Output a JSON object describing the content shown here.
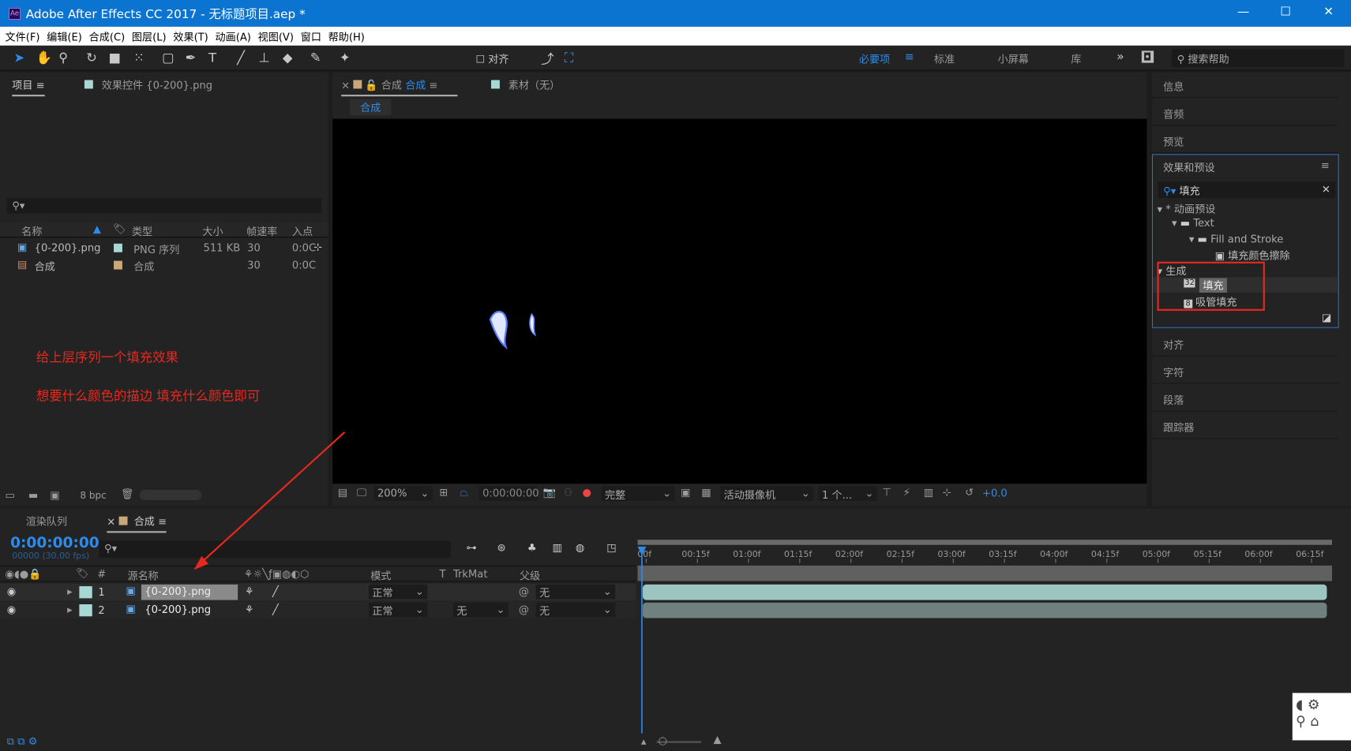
{
  "window": {
    "title": "Adobe After Effects CC 2017 - 无标题项目.aep *",
    "app_icon": "Ae",
    "controls": [
      "—",
      "☐",
      "✕"
    ]
  },
  "menu": [
    "文件(F)",
    "编辑(E)",
    "合成(C)",
    "图层(L)",
    "效果(T)",
    "动画(A)",
    "视图(V)",
    "窗口",
    "帮助(H)"
  ],
  "toolbar": {
    "align_label": "对齐",
    "workspaces": [
      "必要项",
      "标准",
      "小屏幕",
      "库"
    ],
    "active_workspace": "必要项",
    "more": "»",
    "search_placeholder": "搜索帮助"
  },
  "project_panel": {
    "tab": "项目",
    "effect_controls_tab": "效果控件 {0-200}.png",
    "columns": [
      "名称",
      "类型",
      "大小",
      "帧速率",
      "入点"
    ],
    "items": [
      {
        "name": "{0-200}.png",
        "type": "PNG 序列",
        "size": "511 KB",
        "fps": "30",
        "in": "0:0C",
        "label_color": "#a8d8d4"
      },
      {
        "name": "合成",
        "type": "合成",
        "size": "",
        "fps": "30",
        "in": "0:0C",
        "label_color": "#c8a878"
      }
    ],
    "bpc": "8 bpc"
  },
  "comp_panel": {
    "tab_prefix": "合成",
    "tab_name": "合成",
    "footage_tab": "素材（无）",
    "subtab": "合成",
    "zoom": "200%",
    "timecode": "0:00:00:00",
    "resolution": "完整",
    "camera": "活动摄像机",
    "views": "1 个...",
    "exposure": "+0.0"
  },
  "annotations": [
    "给上层序列一个填充效果",
    "想要什么颜色的描边 填充什么颜色即可"
  ],
  "right_panel": {
    "top_items": [
      "信息",
      "音频",
      "预览"
    ],
    "bottom_items": [
      "对齐",
      "字符",
      "段落",
      "跟踪器"
    ],
    "effects": {
      "title": "效果和预设",
      "search": "填充",
      "tree": [
        {
          "label": "* 动画预设",
          "level": 0
        },
        {
          "label": "Text",
          "level": 1
        },
        {
          "label": "Fill and Stroke",
          "level": 2
        },
        {
          "label": "填充颜色擦除",
          "level": 3
        },
        {
          "label": "生成",
          "level": 0
        },
        {
          "label": "填充",
          "level": 1,
          "badge": "32",
          "selected": true
        },
        {
          "label": "吸管填充",
          "level": 1,
          "badge": "8"
        }
      ]
    }
  },
  "timeline": {
    "tabs": [
      "渲染队列",
      "合成"
    ],
    "timecode": "0:00:00:00",
    "frame_info": "00000 (30.00 fps)",
    "columns": {
      "name": "源名称",
      "mode": "模式",
      "trkmat": "TrkMat",
      "parent": "父级",
      "t": "T",
      "num": "#"
    },
    "layers": [
      {
        "num": "1",
        "name": "{0-200}.png",
        "mode": "正常",
        "trkmat": "",
        "parent": "无"
      },
      {
        "num": "2",
        "name": "{0-200}.png",
        "mode": "正常",
        "trkmat": "无",
        "parent": "无"
      }
    ],
    "ruler": [
      "00f",
      "00:15f",
      "01:00f",
      "01:15f",
      "02:00f",
      "02:15f",
      "03:00f",
      "03:15f",
      "04:00f",
      "04:15f",
      "05:00f",
      "05:15f",
      "06:00f",
      "06:15f"
    ]
  },
  "colors": {
    "accent": "#2d8ceb",
    "annotation": "#e8281e",
    "title_bar": "#0b74d1",
    "layer_bar": "#9cc4c0"
  }
}
